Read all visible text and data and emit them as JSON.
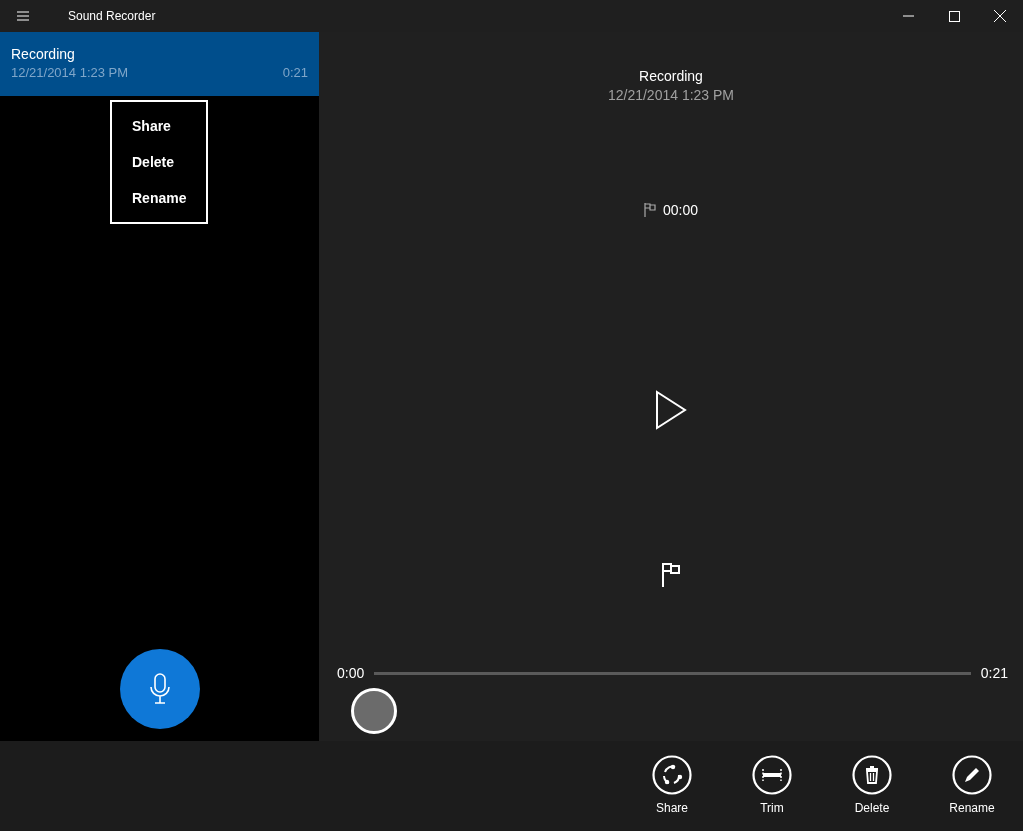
{
  "window": {
    "title": "Sound Recorder"
  },
  "recordings": [
    {
      "name": "Recording",
      "date": "12/21/2014 1:23 PM",
      "duration": "0:21",
      "selected": true
    }
  ],
  "context_menu": {
    "items": [
      "Share",
      "Delete",
      "Rename"
    ]
  },
  "player": {
    "title": "Recording",
    "date": "12/21/2014 1:23 PM",
    "marker_time": "00:00",
    "start": "0:00",
    "end": "0:21",
    "level": 0
  },
  "actions": [
    {
      "kind": "share",
      "label": "Share"
    },
    {
      "kind": "trim",
      "label": "Trim"
    },
    {
      "kind": "delete",
      "label": "Delete"
    },
    {
      "kind": "rename",
      "label": "Rename"
    }
  ]
}
